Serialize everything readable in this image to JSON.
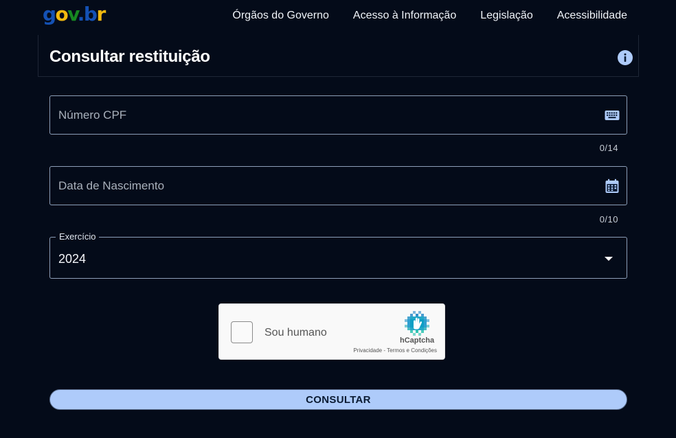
{
  "header": {
    "logo_text": "gov.br",
    "nav": [
      {
        "label": "Órgãos do Governo"
      },
      {
        "label": "Acesso à Informação"
      },
      {
        "label": "Legislação"
      },
      {
        "label": "Acessibilidade"
      }
    ]
  },
  "page": {
    "title": "Consultar restituição"
  },
  "form": {
    "cpf": {
      "placeholder": "Número CPF",
      "value": "",
      "counter": "0/14"
    },
    "birth_date": {
      "placeholder": "Data de Nascimento",
      "value": "",
      "counter": "0/10"
    },
    "exercise": {
      "label": "Exercício",
      "value": "2024"
    },
    "submit_label": "CONSULTAR"
  },
  "captcha": {
    "label": "Sou humano",
    "brand": "hCaptcha",
    "links": "Privacidade - Termos e Condições"
  },
  "colors": {
    "background": "#040b19",
    "accent_button": "#aecbfa",
    "info_icon": "#aecbfa"
  },
  "icons": {
    "info": "info-icon",
    "cpf": "keyboard-icon",
    "date": "calendar-icon",
    "select": "caret-down-icon",
    "captcha": "hcaptcha-logo-icon"
  }
}
